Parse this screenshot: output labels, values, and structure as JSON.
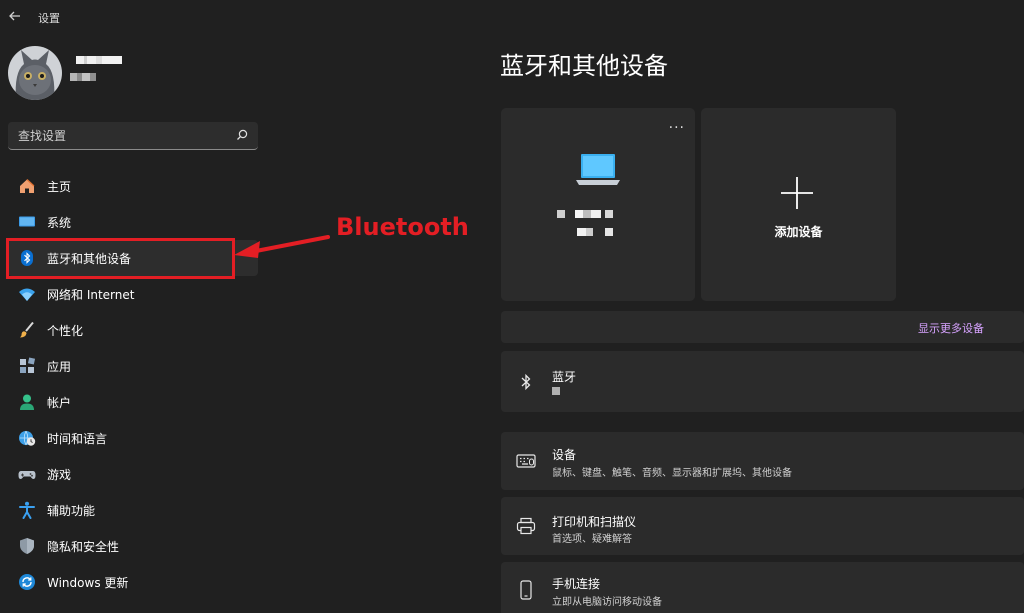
{
  "window": {
    "title": "设置"
  },
  "search": {
    "placeholder": "查找设置"
  },
  "nav": {
    "items": [
      {
        "label": "主页"
      },
      {
        "label": "系统"
      },
      {
        "label": "蓝牙和其他设备"
      },
      {
        "label": "网络和 Internet"
      },
      {
        "label": "个性化"
      },
      {
        "label": "应用"
      },
      {
        "label": "帐户"
      },
      {
        "label": "时间和语言"
      },
      {
        "label": "游戏"
      },
      {
        "label": "辅助功能"
      },
      {
        "label": "隐私和安全性"
      },
      {
        "label": "Windows 更新"
      }
    ],
    "active_index": 2
  },
  "annotation": {
    "label": "Bluetooth",
    "color": "#e31e24"
  },
  "main": {
    "title": "蓝牙和其他设备",
    "more_options": "···",
    "add_device_label": "添加设备",
    "show_more_label": "显示更多设备",
    "rows": {
      "bluetooth": {
        "title": "蓝牙"
      },
      "devices": {
        "title": "设备",
        "subtitle": "鼠标、键盘、触笔、音频、显示器和扩展坞、其他设备"
      },
      "printers": {
        "title": "打印机和扫描仪",
        "subtitle": "首选项、疑难解答"
      },
      "phone": {
        "title": "手机连接",
        "subtitle": "立即从电脑访问移动设备"
      }
    }
  },
  "colors": {
    "background": "#202020",
    "card": "#2b2b2b",
    "link": "#d7a3ff",
    "accent": "#0078d4"
  }
}
